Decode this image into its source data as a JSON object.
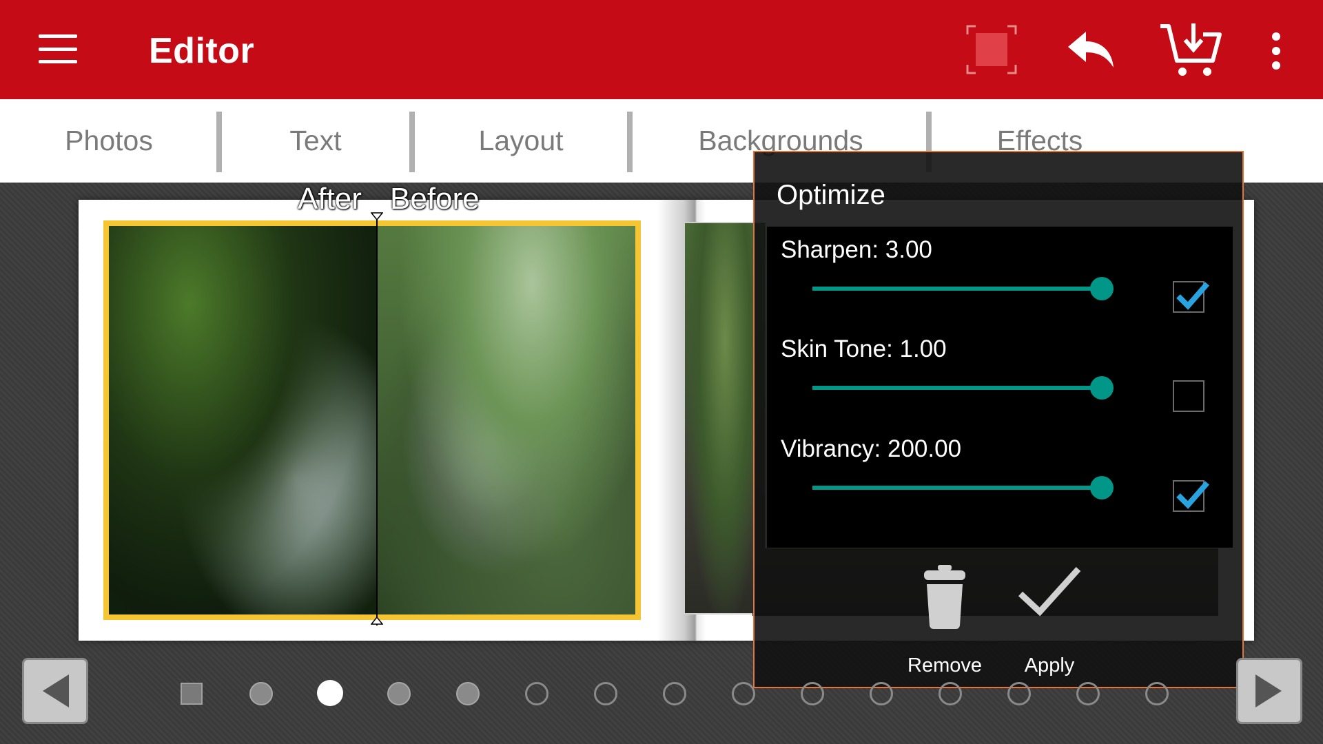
{
  "appbar": {
    "title": "Editor",
    "bg_color": "#c50c16",
    "icons": [
      "menu-icon",
      "frame-select-icon",
      "undo-icon",
      "cart-download-icon",
      "more-vert-icon"
    ]
  },
  "tabs": [
    {
      "label": "Photos"
    },
    {
      "label": "Text"
    },
    {
      "label": "Layout"
    },
    {
      "label": "Backgrounds"
    },
    {
      "label": "Effects"
    }
  ],
  "canvas": {
    "after_label": "After",
    "before_label": "Before",
    "frame_color": "#f6c532"
  },
  "optimize": {
    "title": "Optimize",
    "accent_color": "#009688",
    "check_color": "#29a3e0",
    "sliders": [
      {
        "label": "Sharpen: 3.00",
        "level": 1.0,
        "checked": true
      },
      {
        "label": "Skin Tone: 1.00",
        "level": 1.0,
        "checked": false
      },
      {
        "label": "Vibrancy: 200.00",
        "level": 1.0,
        "checked": true
      }
    ],
    "remove_label": "Remove",
    "apply_label": "Apply"
  },
  "pagination": {
    "total": 15,
    "current": 3,
    "filled": [
      2,
      4,
      5
    ],
    "first_is_cover": true
  }
}
